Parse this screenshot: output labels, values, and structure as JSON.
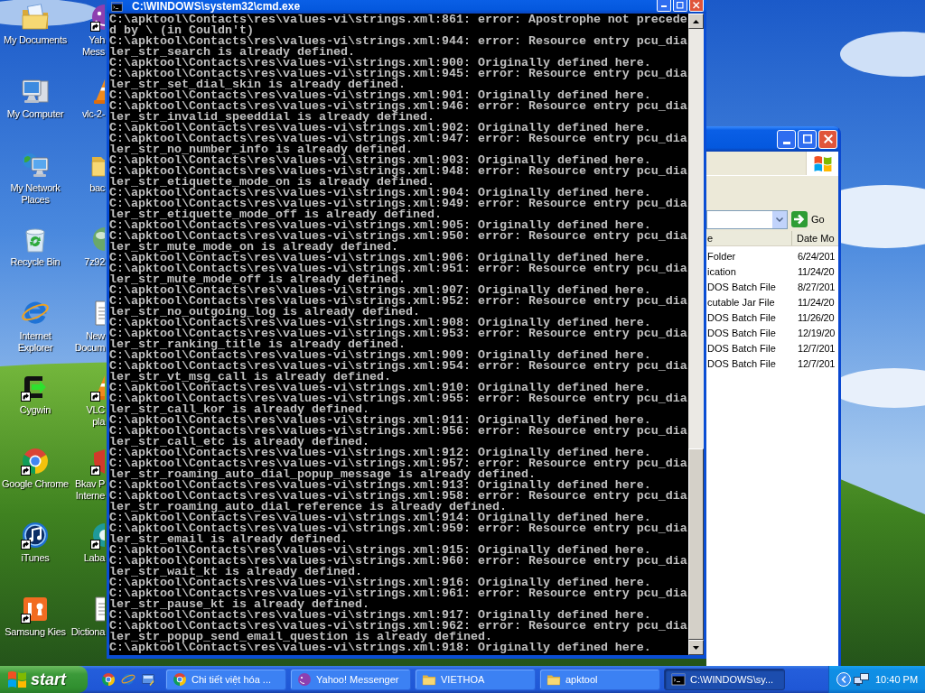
{
  "desktop_icons": {
    "column_1": [
      {
        "kind": "documents",
        "lines": [
          "My Documents"
        ],
        "shortcut": false
      },
      {
        "kind": "computer",
        "lines": [
          "My Computer"
        ],
        "shortcut": false
      },
      {
        "kind": "network",
        "lines": [
          "My Network",
          "Places"
        ],
        "shortcut": false
      },
      {
        "kind": "recycle",
        "lines": [
          "Recycle Bin"
        ],
        "shortcut": false
      },
      {
        "kind": "ie",
        "lines": [
          "Internet",
          "Explorer"
        ],
        "shortcut": false
      },
      {
        "kind": "terminal",
        "lines": [
          "Cygwin"
        ],
        "shortcut": true
      },
      {
        "kind": "chrome",
        "lines": [
          "Google Chrome"
        ],
        "shortcut": true
      },
      {
        "kind": "itunes",
        "lines": [
          "iTunes"
        ],
        "shortcut": true
      },
      {
        "kind": "kies",
        "lines": [
          "Samsung Kies"
        ],
        "shortcut": true
      }
    ],
    "column_2": [
      {
        "kind": "messenger",
        "lines": [
          "Yah",
          "Mess"
        ],
        "shortcut": true
      },
      {
        "kind": "cone",
        "lines": [
          "vlc-2-"
        ],
        "shortcut": false
      },
      {
        "kind": "folder",
        "lines": [
          "bac"
        ],
        "shortcut": false
      },
      {
        "kind": "globe",
        "lines": [
          "7z92"
        ],
        "shortcut": false
      },
      {
        "kind": "document",
        "lines": [
          "New",
          "Docum"
        ],
        "shortcut": false
      },
      {
        "kind": "cone",
        "lines": [
          "VLC",
          "pla"
        ],
        "shortcut": true
      },
      {
        "kind": "shield",
        "lines": [
          "Bkav P",
          "Interne"
        ],
        "shortcut": true
      },
      {
        "kind": "ring",
        "lines": [
          "Laba"
        ],
        "shortcut": true
      },
      {
        "kind": "document",
        "lines": [
          "Dictiona"
        ],
        "shortcut": false
      }
    ]
  },
  "console_window": {
    "title": "C:\\WINDOWS\\system32\\cmd.exe",
    "lines": [
      "C:\\apktool\\Contacts\\res\\values-vi\\strings.xml:861: error: Apostrophe not precede",
      "d by \\ (in Couldn't)",
      "C:\\apktool\\Contacts\\res\\values-vi\\strings.xml:944: error: Resource entry pcu_dia",
      "ler_str_search is already defined.",
      "C:\\apktool\\Contacts\\res\\values-vi\\strings.xml:900: Originally defined here.",
      "C:\\apktool\\Contacts\\res\\values-vi\\strings.xml:945: error: Resource entry pcu_dia",
      "ler_str_set_dial_skin is already defined.",
      "C:\\apktool\\Contacts\\res\\values-vi\\strings.xml:901: Originally defined here.",
      "C:\\apktool\\Contacts\\res\\values-vi\\strings.xml:946: error: Resource entry pcu_dia",
      "ler_str_invalid_speeddial is already defined.",
      "C:\\apktool\\Contacts\\res\\values-vi\\strings.xml:902: Originally defined here.",
      "C:\\apktool\\Contacts\\res\\values-vi\\strings.xml:947: error: Resource entry pcu_dia",
      "ler_str_no_number_info is already defined.",
      "C:\\apktool\\Contacts\\res\\values-vi\\strings.xml:903: Originally defined here.",
      "C:\\apktool\\Contacts\\res\\values-vi\\strings.xml:948: error: Resource entry pcu_dia",
      "ler_str_etiquette_mode_on is already defined.",
      "C:\\apktool\\Contacts\\res\\values-vi\\strings.xml:904: Originally defined here.",
      "C:\\apktool\\Contacts\\res\\values-vi\\strings.xml:949: error: Resource entry pcu_dia",
      "ler_str_etiquette_mode_off is already defined.",
      "C:\\apktool\\Contacts\\res\\values-vi\\strings.xml:905: Originally defined here.",
      "C:\\apktool\\Contacts\\res\\values-vi\\strings.xml:950: error: Resource entry pcu_dia",
      "ler_str_mute_mode_on is already defined.",
      "C:\\apktool\\Contacts\\res\\values-vi\\strings.xml:906: Originally defined here.",
      "C:\\apktool\\Contacts\\res\\values-vi\\strings.xml:951: error: Resource entry pcu_dia",
      "ler_str_mute_mode_off is already defined.",
      "C:\\apktool\\Contacts\\res\\values-vi\\strings.xml:907: Originally defined here.",
      "C:\\apktool\\Contacts\\res\\values-vi\\strings.xml:952: error: Resource entry pcu_dia",
      "ler_str_no_outgoing_log is already defined.",
      "C:\\apktool\\Contacts\\res\\values-vi\\strings.xml:908: Originally defined here.",
      "C:\\apktool\\Contacts\\res\\values-vi\\strings.xml:953: error: Resource entry pcu_dia",
      "ler_str_ranking_title is already defined.",
      "C:\\apktool\\Contacts\\res\\values-vi\\strings.xml:909: Originally defined here.",
      "C:\\apktool\\Contacts\\res\\values-vi\\strings.xml:954: error: Resource entry pcu_dia",
      "ler_str_vt_msg_call is already defined.",
      "C:\\apktool\\Contacts\\res\\values-vi\\strings.xml:910: Originally defined here.",
      "C:\\apktool\\Contacts\\res\\values-vi\\strings.xml:955: error: Resource entry pcu_dia",
      "ler_str_call_kor is already defined.",
      "C:\\apktool\\Contacts\\res\\values-vi\\strings.xml:911: Originally defined here.",
      "C:\\apktool\\Contacts\\res\\values-vi\\strings.xml:956: error: Resource entry pcu_dia",
      "ler_str_call_etc is already defined.",
      "C:\\apktool\\Contacts\\res\\values-vi\\strings.xml:912: Originally defined here.",
      "C:\\apktool\\Contacts\\res\\values-vi\\strings.xml:957: error: Resource entry pcu_dia",
      "ler_str_roaming_auto_dial_popup_message is already defined.",
      "C:\\apktool\\Contacts\\res\\values-vi\\strings.xml:913: Originally defined here.",
      "C:\\apktool\\Contacts\\res\\values-vi\\strings.xml:958: error: Resource entry pcu_dia",
      "ler_str_roaming_auto_dial_reference is already defined.",
      "C:\\apktool\\Contacts\\res\\values-vi\\strings.xml:914: Originally defined here.",
      "C:\\apktool\\Contacts\\res\\values-vi\\strings.xml:959: error: Resource entry pcu_dia",
      "ler_str_email is already defined.",
      "C:\\apktool\\Contacts\\res\\values-vi\\strings.xml:915: Originally defined here.",
      "C:\\apktool\\Contacts\\res\\values-vi\\strings.xml:960: error: Resource entry pcu_dia",
      "ler_str_wait_kt is already defined.",
      "C:\\apktool\\Contacts\\res\\values-vi\\strings.xml:916: Originally defined here.",
      "C:\\apktool\\Contacts\\res\\values-vi\\strings.xml:961: error: Resource entry pcu_dia",
      "ler_str_pause_kt is already defined.",
      "C:\\apktool\\Contacts\\res\\values-vi\\strings.xml:917: Originally defined here.",
      "C:\\apktool\\Contacts\\res\\values-vi\\strings.xml:962: error: Resource entry pcu_dia",
      "ler_str_popup_send_email_question is already defined.",
      "C:\\apktool\\Contacts\\res\\values-vi\\strings.xml:918: Originally defined here."
    ]
  },
  "explorer_window": {
    "go_button": "Go",
    "columns": [
      "e",
      "Date Mo"
    ],
    "rows": [
      [
        "Folder",
        "6/24/201"
      ],
      [
        "ication",
        "11/24/20"
      ],
      [
        "DOS Batch File",
        "8/27/201"
      ],
      [
        "cutable Jar File",
        "11/24/20"
      ],
      [
        "DOS Batch File",
        "11/26/20"
      ],
      [
        "DOS Batch File",
        "12/19/20"
      ],
      [
        "DOS Batch File",
        "12/7/201"
      ],
      [
        "DOS Batch File",
        "12/7/201"
      ]
    ]
  },
  "taskbar": {
    "start_button": "start",
    "quick_launch": [
      {
        "kind": "chrome"
      },
      {
        "kind": "ie"
      },
      {
        "kind": "desktop"
      }
    ],
    "tasks": [
      {
        "kind": "chrome",
        "label": "Chi tiết việt hóa ...",
        "selected": false
      },
      {
        "kind": "messenger",
        "label": "Yahoo! Messenger",
        "selected": false
      },
      {
        "kind": "folder",
        "label": "VIETHOA",
        "selected": false
      },
      {
        "kind": "folder",
        "label": "apktool",
        "selected": false
      },
      {
        "kind": "console",
        "label": "C:\\WINDOWS\\sy...",
        "selected": true
      }
    ],
    "clock": "10:40 PM"
  }
}
